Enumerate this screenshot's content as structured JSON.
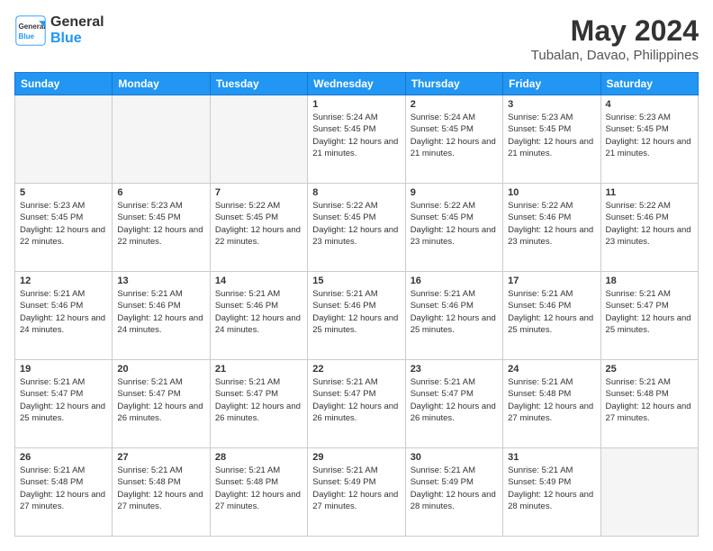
{
  "logo": {
    "line1": "General",
    "line2": "Blue"
  },
  "title": "May 2024",
  "subtitle": "Tubalan, Davao, Philippines",
  "days_of_week": [
    "Sunday",
    "Monday",
    "Tuesday",
    "Wednesday",
    "Thursday",
    "Friday",
    "Saturday"
  ],
  "weeks": [
    [
      {
        "day": "",
        "empty": true
      },
      {
        "day": "",
        "empty": true
      },
      {
        "day": "",
        "empty": true
      },
      {
        "day": "1",
        "sunrise": "5:24 AM",
        "sunset": "5:45 PM",
        "daylight": "12 hours and 21 minutes."
      },
      {
        "day": "2",
        "sunrise": "5:24 AM",
        "sunset": "5:45 PM",
        "daylight": "12 hours and 21 minutes."
      },
      {
        "day": "3",
        "sunrise": "5:23 AM",
        "sunset": "5:45 PM",
        "daylight": "12 hours and 21 minutes."
      },
      {
        "day": "4",
        "sunrise": "5:23 AM",
        "sunset": "5:45 PM",
        "daylight": "12 hours and 21 minutes."
      }
    ],
    [
      {
        "day": "5",
        "sunrise": "5:23 AM",
        "sunset": "5:45 PM",
        "daylight": "12 hours and 22 minutes."
      },
      {
        "day": "6",
        "sunrise": "5:23 AM",
        "sunset": "5:45 PM",
        "daylight": "12 hours and 22 minutes."
      },
      {
        "day": "7",
        "sunrise": "5:22 AM",
        "sunset": "5:45 PM",
        "daylight": "12 hours and 22 minutes."
      },
      {
        "day": "8",
        "sunrise": "5:22 AM",
        "sunset": "5:45 PM",
        "daylight": "12 hours and 23 minutes."
      },
      {
        "day": "9",
        "sunrise": "5:22 AM",
        "sunset": "5:45 PM",
        "daylight": "12 hours and 23 minutes."
      },
      {
        "day": "10",
        "sunrise": "5:22 AM",
        "sunset": "5:46 PM",
        "daylight": "12 hours and 23 minutes."
      },
      {
        "day": "11",
        "sunrise": "5:22 AM",
        "sunset": "5:46 PM",
        "daylight": "12 hours and 23 minutes."
      }
    ],
    [
      {
        "day": "12",
        "sunrise": "5:21 AM",
        "sunset": "5:46 PM",
        "daylight": "12 hours and 24 minutes."
      },
      {
        "day": "13",
        "sunrise": "5:21 AM",
        "sunset": "5:46 PM",
        "daylight": "12 hours and 24 minutes."
      },
      {
        "day": "14",
        "sunrise": "5:21 AM",
        "sunset": "5:46 PM",
        "daylight": "12 hours and 24 minutes."
      },
      {
        "day": "15",
        "sunrise": "5:21 AM",
        "sunset": "5:46 PM",
        "daylight": "12 hours and 25 minutes."
      },
      {
        "day": "16",
        "sunrise": "5:21 AM",
        "sunset": "5:46 PM",
        "daylight": "12 hours and 25 minutes."
      },
      {
        "day": "17",
        "sunrise": "5:21 AM",
        "sunset": "5:46 PM",
        "daylight": "12 hours and 25 minutes."
      },
      {
        "day": "18",
        "sunrise": "5:21 AM",
        "sunset": "5:47 PM",
        "daylight": "12 hours and 25 minutes."
      }
    ],
    [
      {
        "day": "19",
        "sunrise": "5:21 AM",
        "sunset": "5:47 PM",
        "daylight": "12 hours and 25 minutes."
      },
      {
        "day": "20",
        "sunrise": "5:21 AM",
        "sunset": "5:47 PM",
        "daylight": "12 hours and 26 minutes."
      },
      {
        "day": "21",
        "sunrise": "5:21 AM",
        "sunset": "5:47 PM",
        "daylight": "12 hours and 26 minutes."
      },
      {
        "day": "22",
        "sunrise": "5:21 AM",
        "sunset": "5:47 PM",
        "daylight": "12 hours and 26 minutes."
      },
      {
        "day": "23",
        "sunrise": "5:21 AM",
        "sunset": "5:47 PM",
        "daylight": "12 hours and 26 minutes."
      },
      {
        "day": "24",
        "sunrise": "5:21 AM",
        "sunset": "5:48 PM",
        "daylight": "12 hours and 27 minutes."
      },
      {
        "day": "25",
        "sunrise": "5:21 AM",
        "sunset": "5:48 PM",
        "daylight": "12 hours and 27 minutes."
      }
    ],
    [
      {
        "day": "26",
        "sunrise": "5:21 AM",
        "sunset": "5:48 PM",
        "daylight": "12 hours and 27 minutes."
      },
      {
        "day": "27",
        "sunrise": "5:21 AM",
        "sunset": "5:48 PM",
        "daylight": "12 hours and 27 minutes."
      },
      {
        "day": "28",
        "sunrise": "5:21 AM",
        "sunset": "5:48 PM",
        "daylight": "12 hours and 27 minutes."
      },
      {
        "day": "29",
        "sunrise": "5:21 AM",
        "sunset": "5:49 PM",
        "daylight": "12 hours and 27 minutes."
      },
      {
        "day": "30",
        "sunrise": "5:21 AM",
        "sunset": "5:49 PM",
        "daylight": "12 hours and 28 minutes."
      },
      {
        "day": "31",
        "sunrise": "5:21 AM",
        "sunset": "5:49 PM",
        "daylight": "12 hours and 28 minutes."
      },
      {
        "day": "",
        "empty": true
      }
    ]
  ]
}
